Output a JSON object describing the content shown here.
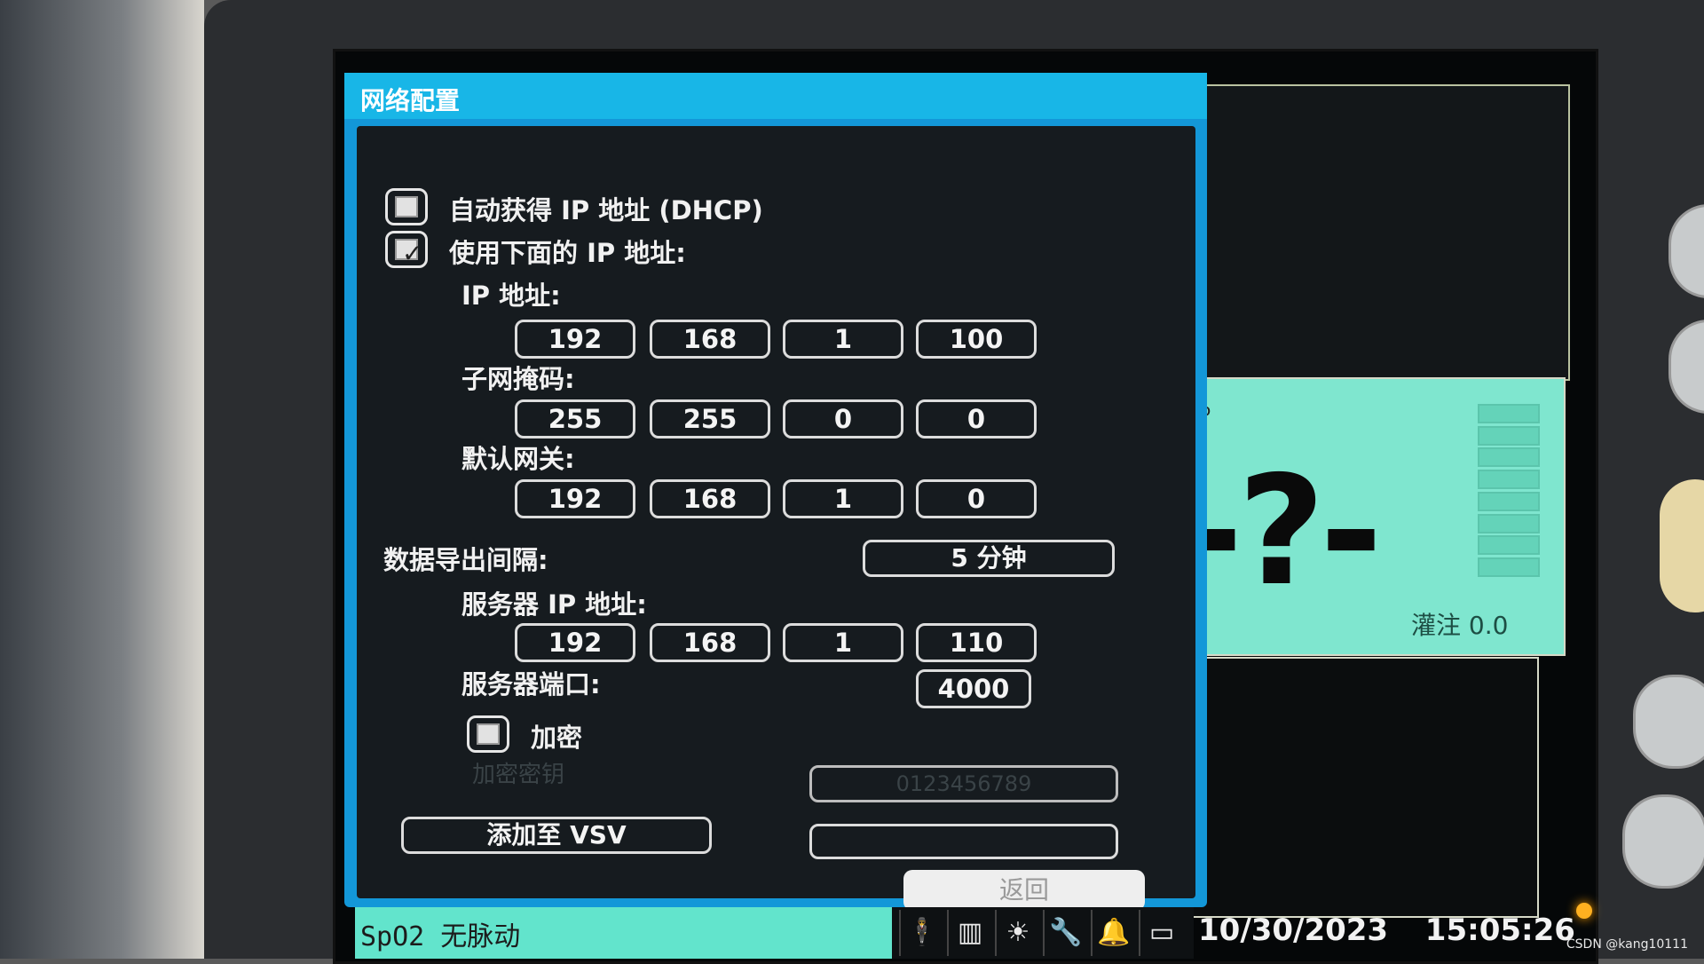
{
  "dialog": {
    "title": "网络配置",
    "dhcp_label": "自动获得 IP 地址 (DHCP)",
    "dhcp_checked": false,
    "static_label": "使用下面的 IP 地址:",
    "static_checked": true,
    "ip_label": "IP 地址:",
    "ip": [
      "192",
      "168",
      "1",
      "100"
    ],
    "subnet_label": "子网掩码:",
    "subnet": [
      "255",
      "255",
      "0",
      "0"
    ],
    "gateway_label": "默认网关:",
    "gateway": [
      "192",
      "168",
      "1",
      "0"
    ],
    "export_interval_label": "数据导出间隔:",
    "export_interval_value": "5 分钟",
    "server_ip_label": "服务器 IP 地址:",
    "server_ip": [
      "192",
      "168",
      "1",
      "110"
    ],
    "server_port_label": "服务器端口:",
    "server_port": "4000",
    "encrypt_label": "加密",
    "encrypt_checked": false,
    "key_label": "加密密钥",
    "key_placeholder": "0123456789",
    "add_vsv_label": "添加至 VSV",
    "vsv_value": "",
    "back_label": "返回"
  },
  "monitor": {
    "value_placeholder": "-?-",
    "unit": "%",
    "perfusion_label": "灌注 0.0"
  },
  "status_bar": {
    "alarm_text": "SpO2 无脉动",
    "icons": [
      "person-icon",
      "bed-icon",
      "brightness-icon",
      "wrench-icon",
      "bell-icon",
      "battery-icon"
    ],
    "date": "10/30/2023",
    "time": "15:05:26"
  },
  "watermark": "CSDN @kang10111",
  "colors": {
    "title_bar": "#18b6e7",
    "dialog_frame": "#1397d8",
    "status_bar": "#62e4cc",
    "parameter_panel": "#7fe6cf"
  }
}
